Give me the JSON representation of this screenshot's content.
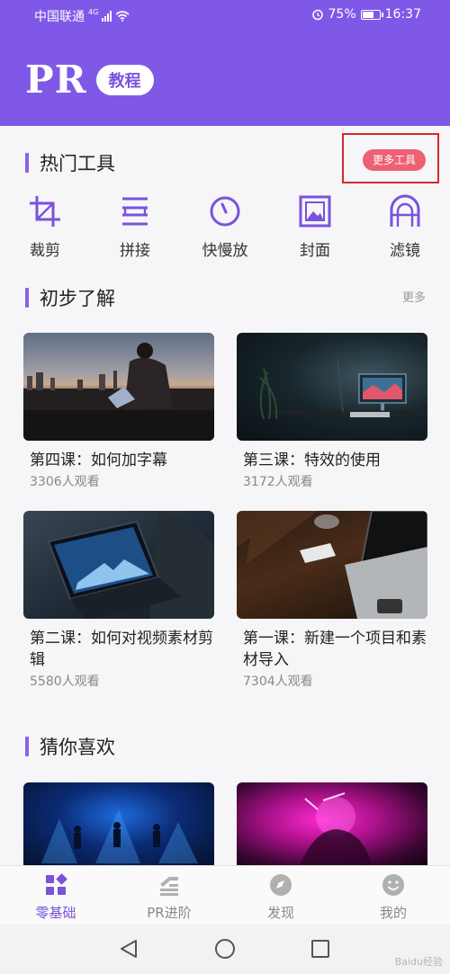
{
  "status_bar": {
    "carrier": "中国联通",
    "network": "4G",
    "battery": "75%",
    "battery_level": 0.75,
    "time": "16:37"
  },
  "header": {
    "logo": "PR",
    "badge": "教程"
  },
  "hot_tools": {
    "title": "热门工具",
    "more_button": "更多工具",
    "items": [
      {
        "label": "裁剪",
        "icon": "crop-icon"
      },
      {
        "label": "拼接",
        "icon": "splice-icon"
      },
      {
        "label": "快慢放",
        "icon": "speed-icon"
      },
      {
        "label": "封面",
        "icon": "cover-image-icon"
      },
      {
        "label": "滤镜",
        "icon": "filter-icon"
      }
    ]
  },
  "intro": {
    "title": "初步了解",
    "more": "更多",
    "lessons": [
      {
        "title": "第四课：如何加字幕",
        "views": "3306人观看"
      },
      {
        "title": "第三课：特效的使用",
        "views": "3172人观看"
      },
      {
        "title": "第二课：如何对视频素材剪辑",
        "views": "5580人观看"
      },
      {
        "title": "第一课：新建一个项目和素材导入",
        "views": "7304人观看"
      }
    ]
  },
  "recommend": {
    "title": "猜你喜欢"
  },
  "bottom_nav": {
    "items": [
      {
        "label": "零基础",
        "icon": "grid-icon",
        "active": true
      },
      {
        "label": "PR进阶",
        "icon": "advance-icon",
        "active": false
      },
      {
        "label": "发现",
        "icon": "compass-icon",
        "active": false
      },
      {
        "label": "我的",
        "icon": "smiley-icon",
        "active": false
      }
    ]
  },
  "colors": {
    "brand": "#8058e8",
    "accent_button": "#ee6074",
    "highlight_frame": "#d6272d"
  },
  "watermark": "Baidu经验"
}
